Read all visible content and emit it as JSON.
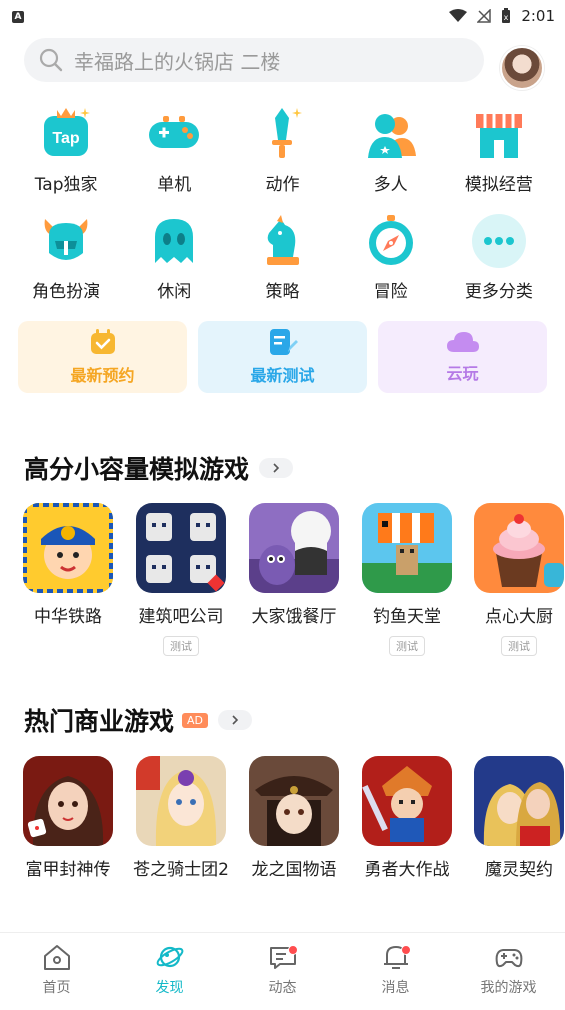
{
  "status_bar": {
    "time": "2:01"
  },
  "search": {
    "placeholder": "幸福路上的火锅店 二楼"
  },
  "categories": [
    {
      "label": "Tap独家",
      "icon": "tap-icon"
    },
    {
      "label": "单机",
      "icon": "gamepad-icon"
    },
    {
      "label": "动作",
      "icon": "sword-icon"
    },
    {
      "label": "多人",
      "icon": "people-icon"
    },
    {
      "label": "模拟经营",
      "icon": "shop-icon"
    },
    {
      "label": "角色扮演",
      "icon": "helmet-icon"
    },
    {
      "label": "休闲",
      "icon": "ghost-icon"
    },
    {
      "label": "策略",
      "icon": "chess-knight-icon"
    },
    {
      "label": "冒险",
      "icon": "compass-icon"
    },
    {
      "label": "更多分类",
      "icon": "more-icon"
    }
  ],
  "quick_links": [
    {
      "label": "最新预约",
      "icon": "calendar-check-icon",
      "color": "#f5a623",
      "bg": "#fff4e2"
    },
    {
      "label": "最新测试",
      "icon": "edit-note-icon",
      "color": "#2aa7e8",
      "bg": "#e4f4fc"
    },
    {
      "label": "云玩",
      "icon": "cloud-icon",
      "color": "#b57ae6",
      "bg": "#f5ecfd"
    }
  ],
  "section1": {
    "title": "高分小容量模拟游戏",
    "games": [
      {
        "name": "中华铁路",
        "tag": ""
      },
      {
        "name": "建筑吧公司",
        "tag": "测试"
      },
      {
        "name": "大家饿餐厅",
        "tag": ""
      },
      {
        "name": "钓鱼天堂",
        "tag": "测试"
      },
      {
        "name": "点心大厨",
        "tag": "测试"
      }
    ]
  },
  "section2": {
    "title": "热门商业游戏",
    "ad": "AD",
    "games": [
      {
        "name": "富甲封神传"
      },
      {
        "name": "苍之骑士团2"
      },
      {
        "name": "龙之国物语"
      },
      {
        "name": "勇者大作战"
      },
      {
        "name": "魔灵契约"
      }
    ]
  },
  "tabs": [
    {
      "label": "首页",
      "icon": "home-icon",
      "active": false,
      "dot": false
    },
    {
      "label": "发现",
      "icon": "planet-icon",
      "active": true,
      "dot": false
    },
    {
      "label": "动态",
      "icon": "chat-icon",
      "active": false,
      "dot": true
    },
    {
      "label": "消息",
      "icon": "bell-icon",
      "active": false,
      "dot": true
    },
    {
      "label": "我的游戏",
      "icon": "gamepad-outline-icon",
      "active": false,
      "dot": false
    }
  ],
  "colors": {
    "accent": "#14b9c8",
    "badge": "#ff4d4f",
    "ad": "#ff8c5a"
  }
}
